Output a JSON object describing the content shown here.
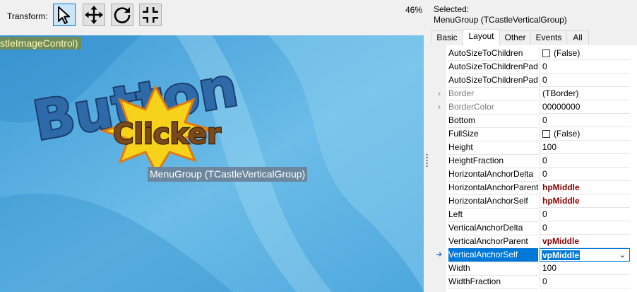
{
  "toolbar": {
    "transform_label": "Transform:",
    "tools": [
      {
        "name": "select",
        "icon": "pointer-arrow-icon"
      },
      {
        "name": "translate",
        "icon": "move-arrows-icon"
      },
      {
        "name": "rotate",
        "icon": "rotate-icon"
      },
      {
        "name": "resize",
        "icon": "shrink-icon"
      }
    ],
    "zoom": "46%"
  },
  "viewport": {
    "control_caption": "stleImageControl)",
    "logo_word1": "Button",
    "logo_word2": "Clicker",
    "selected_caption": "MenuGroup (TCastleVerticalGroup)"
  },
  "inspector": {
    "selected_label": "Selected:",
    "selected_value": "MenuGroup (TCastleVerticalGroup)",
    "tabs": [
      "Basic",
      "Layout",
      "Other",
      "Events",
      "All"
    ],
    "active_tab": "Layout",
    "properties": [
      {
        "name": "AutoSizeToChildren",
        "value": "(False)",
        "checkbox": true
      },
      {
        "name": "AutoSizeToChildrenPaddingBottom",
        "value": "0"
      },
      {
        "name": "AutoSizeToChildrenPaddingRight",
        "value": "0"
      },
      {
        "name": "Border",
        "value": "(TBorder)",
        "expandable": true
      },
      {
        "name": "BorderColor",
        "value": "00000000",
        "expandable": true
      },
      {
        "name": "Bottom",
        "value": "0"
      },
      {
        "name": "FullSize",
        "value": "(False)",
        "checkbox": true
      },
      {
        "name": "Height",
        "value": "100"
      },
      {
        "name": "HeightFraction",
        "value": "0"
      },
      {
        "name": "HorizontalAnchorDelta",
        "value": "0"
      },
      {
        "name": "HorizontalAnchorParent",
        "value": "hpMiddle",
        "bold": true
      },
      {
        "name": "HorizontalAnchorSelf",
        "value": "hpMiddle",
        "bold": true
      },
      {
        "name": "Left",
        "value": "0"
      },
      {
        "name": "VerticalAnchorDelta",
        "value": "0"
      },
      {
        "name": "VerticalAnchorParent",
        "value": "vpMiddle",
        "bold": true
      },
      {
        "name": "VerticalAnchorSelf",
        "value": "vpMiddle",
        "bold": true,
        "selected": true
      },
      {
        "name": "Width",
        "value": "100"
      },
      {
        "name": "WidthFraction",
        "value": "0"
      }
    ]
  },
  "colors": {
    "accent": "#0078d7",
    "modified_value": "#8b0000",
    "viewport_bg": "#5fb2e0",
    "logo_blue": "#2f6aa8",
    "logo_star": "#f7d21a",
    "logo_brown": "#7a4a1c"
  }
}
